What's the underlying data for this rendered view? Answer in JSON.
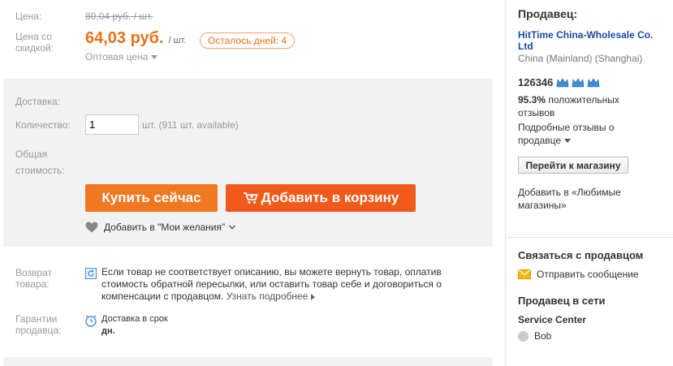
{
  "product": {
    "price_label": "Цена:",
    "old_price": "80,04 руб. / шт.",
    "discount_label_line1": "Цена со",
    "discount_label_line2": "скидкой:",
    "price": "64,03 руб.",
    "price_unit": "/ шт.",
    "days_left": "Осталось дней: 4",
    "bulk_price": "Оптовая цена",
    "delivery_label": "Доставка:",
    "quantity_label": "Количество:",
    "quantity_value": "1",
    "quantity_avail": "шт. (911 шт. available)",
    "total_label_line1": "Общая",
    "total_label_line2": "стоимость:",
    "buy_now": "Купить сейчас",
    "add_to_cart": "Добавить в корзину",
    "wishlist": "Добавить в \"Мои желания\"",
    "return_label_line1": "Возврат",
    "return_label_line2": "товара:",
    "return_text_line1": "Если товар не соответствует описанию, вы можете вернуть товар, оплатив",
    "return_text_line2": "стоимость обратной пересылки, или оставить товар себе и договориться о",
    "return_text_line3": "компенсации с продавцом.",
    "learn_more": "Узнать подробнее",
    "guarantee_label_line1": "Гарантии",
    "guarantee_label_line2": "продавца:",
    "guarantee_text": "Доставка в срок",
    "guarantee_days": "дн."
  },
  "seller": {
    "title": "Продавец:",
    "name_line1": "HitTime China-Wholesale Co.",
    "name_line2": "Ltd",
    "location": "China (Mainland) (Shanghai)",
    "score": "126346",
    "positive_pct": "95.3%",
    "positive_text_line1": "положительных",
    "positive_text_line2": "отзывов",
    "detailed_line1": "Подробные отзывы о",
    "detailed_line2": "продавце",
    "store_button": "Перейти к магазину",
    "fav_line1": "Добавить в «Любимые",
    "fav_line2": "магазины»",
    "contact_title": "Связаться с продавцом",
    "send_message": "Отправить сообщение",
    "online_title": "Продавец в сети",
    "service_center": "Service Center",
    "agent": "Bob"
  },
  "colors": {
    "accent_orange": "#e5731a",
    "buy_button": "#f07820",
    "cart_button": "#f05a1a",
    "link_blue": "#1a4aa8"
  }
}
